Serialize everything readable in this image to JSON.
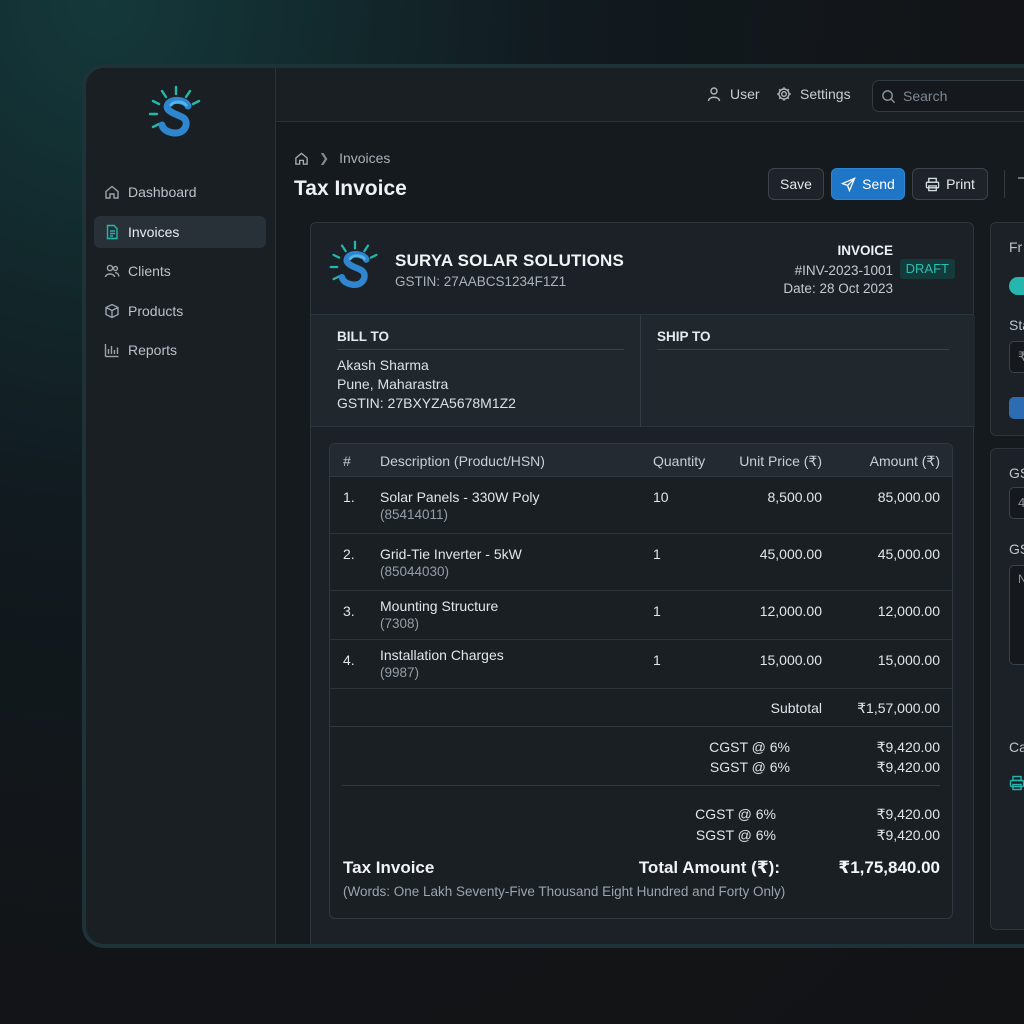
{
  "topbar": {
    "user_label": "User",
    "settings_label": "Settings",
    "search_placeholder": "Search"
  },
  "sidebar": {
    "items": [
      {
        "label": "Dashboard",
        "icon": "home-icon",
        "active": false
      },
      {
        "label": "Invoices",
        "icon": "document-icon",
        "active": true
      },
      {
        "label": "Clients",
        "icon": "users-icon",
        "active": false
      },
      {
        "label": "Products",
        "icon": "box-icon",
        "active": false
      },
      {
        "label": "Reports",
        "icon": "bar-chart-icon",
        "active": false
      }
    ]
  },
  "breadcrumb": {
    "current": "Invoices"
  },
  "page_title": "Tax Invoice",
  "actions": {
    "save": "Save",
    "send": "Send",
    "print": "Print"
  },
  "invoice": {
    "company_name": "SURYA SOLAR SOLUTIONS",
    "company_gstin": "GSTIN: 27AABCS1234F1Z1",
    "label": "INVOICE",
    "number": "#INV-2023-1001",
    "status": "DRAFT",
    "date": "Date: 28 Oct 2023",
    "bill_to": {
      "heading": "BILL TO",
      "name": "Akash Sharma",
      "city": "Pune, Maharastra",
      "gstin": "GSTIN: 27BXYZA5678M1Z2"
    },
    "ship_to": {
      "heading": "SHIP TO"
    },
    "columns": [
      "#",
      "Description (Product/HSN)",
      "Quantity",
      "Unit Price (₹)",
      "Amount (₹)"
    ],
    "rows": [
      {
        "no": "1.",
        "desc": "Solar Panels - 330W Poly",
        "hsn": "(85414011)",
        "qty": "10",
        "unit": "8,500.00",
        "amount": "85,000.00"
      },
      {
        "no": "2.",
        "desc": "Grid-Tie Inverter - 5kW",
        "hsn": "(85044030)",
        "qty": "1",
        "unit": "45,000.00",
        "amount": "45,000.00"
      },
      {
        "no": "3.",
        "desc": "Mounting Structure",
        "hsn": "(7308)",
        "qty": "1",
        "unit": "12,000.00",
        "amount": "12,000.00"
      },
      {
        "no": "4.",
        "desc": "Installation Charges",
        "hsn": "(9987)",
        "qty": "1",
        "unit": "15,000.00",
        "amount": "15,000.00"
      }
    ],
    "subtotal_label": "Subtotal",
    "subtotal": "₹1,57,000.00",
    "tax_block_1": {
      "cgst_label": "CGST @ 6%",
      "cgst": "₹9,420.00",
      "sgst_label": "SGST @ 6%",
      "sgst": "₹9,420.00"
    },
    "tax_block_2": {
      "cgst_label": "CGST @ 6%",
      "cgst": "₹9,420.00",
      "sgst_label": "SGST @ 6%",
      "sgst": "₹9,420.00"
    },
    "footer_label": "Tax Invoice",
    "total_label": "Total Amount (₹):",
    "total": "₹1,75,840.00",
    "words": "(Words: One Lakh Seventy-Five Thousand Eight Hundred and Forty Only)"
  },
  "right_panel": {
    "label_1": "Fr",
    "label_2": "Sta",
    "input_1": "₹",
    "label_3": "GS",
    "input_2": "4",
    "label_4": "GS",
    "area_text": "N",
    "label_5": "Ca"
  },
  "colors": {
    "accent": "#1f76c7",
    "teal": "#25b7ad",
    "draft_badge": "#27c1b4"
  }
}
